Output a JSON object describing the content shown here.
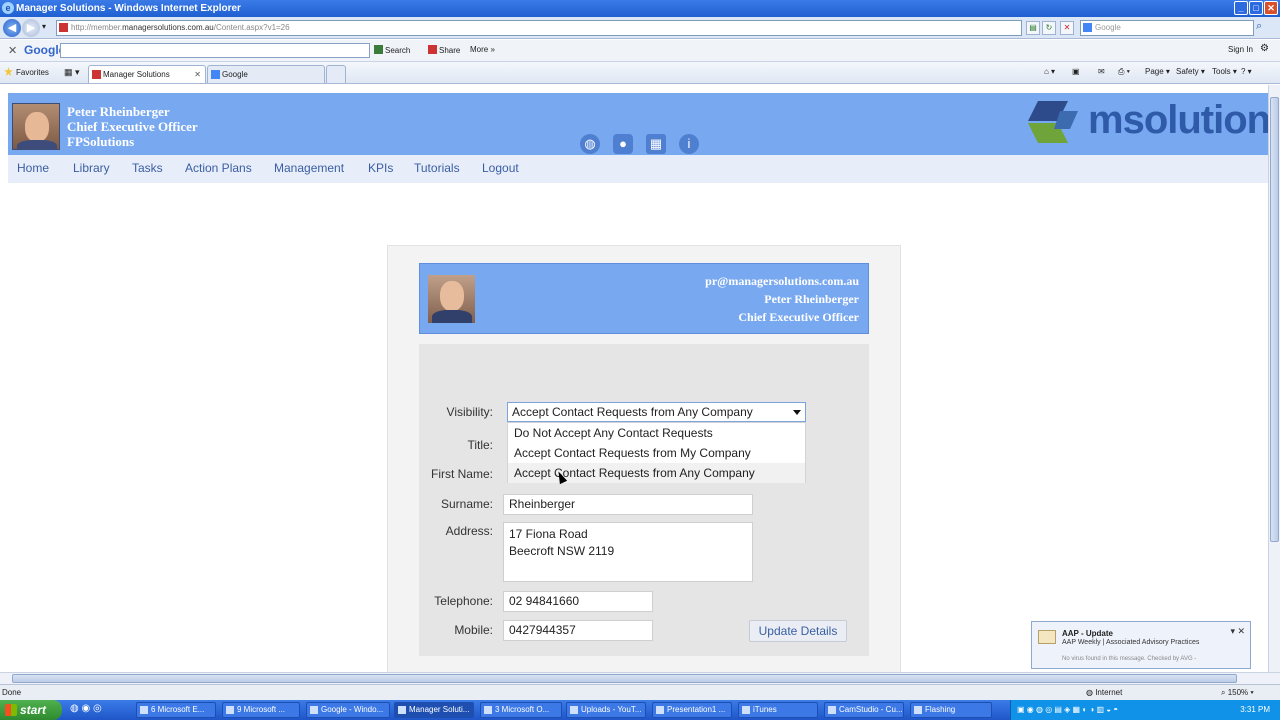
{
  "window": {
    "title": "Manager Solutions - Windows Internet Explorer",
    "url_prefix": "http://member.",
    "url_domain": "managersolutions.com.au",
    "url_path": "/Content.aspx?v1=26",
    "search_placeholder": "Google"
  },
  "google_toolbar": {
    "logo": "Google",
    "search_label": "Search",
    "share_label": "Share",
    "more_label": "More »",
    "signin_label": "Sign In"
  },
  "favorites": {
    "label": "Favorites",
    "tabs": [
      {
        "label": "Manager Solutions"
      },
      {
        "label": "Google"
      }
    ],
    "commands": [
      "Page",
      "Safety",
      "Tools"
    ]
  },
  "header": {
    "name": "Peter Rheinberger",
    "role": "Chief Executive Officer",
    "company": "FPSolutions",
    "brand": "msolutions",
    "icons": [
      "globe-icon",
      "user-icon",
      "calendar-icon",
      "info-icon"
    ]
  },
  "nav": {
    "items": [
      "Home",
      "Library",
      "Tasks",
      "Action Plans",
      "Management",
      "KPIs",
      "Tutorials",
      "Logout"
    ]
  },
  "card": {
    "email": "pr@managersolutions.com.au",
    "name": "Peter Rheinberger",
    "role": "Chief Executive Officer"
  },
  "form": {
    "visibility_label": "Visibility:",
    "visibility_value": "Accept Contact Requests from Any Company",
    "visibility_options": [
      "Do Not Accept Any Contact Requests",
      "Accept Contact Requests from My Company",
      "Accept Contact Requests from Any Company"
    ],
    "title_label": "Title:",
    "firstname_label": "First Name:",
    "surname_label": "Surname:",
    "surname_value": "Rheinberger",
    "address_label": "Address:",
    "address_value": "17 Fiona Road\nBeecroft NSW 2119",
    "telephone_label": "Telephone:",
    "telephone_value": "02 94841660",
    "mobile_label": "Mobile:",
    "mobile_value": "0427944357",
    "update_button": "Update Details"
  },
  "notification": {
    "title": "AAP - Update",
    "subtitle": "AAP Weekly | Associated Advisory Practices",
    "footer": "No virus found in this message. Checked by AVG -"
  },
  "status": {
    "left": "Done",
    "zone": "Internet",
    "zoom": "150%"
  },
  "taskbar": {
    "start": "start",
    "tasks": [
      {
        "label": "6 Microsoft E..."
      },
      {
        "label": "9 Microsoft ..."
      },
      {
        "label": "Google - Windo..."
      },
      {
        "label": "Manager Soluti..."
      },
      {
        "label": "3 Microsoft O..."
      },
      {
        "label": "Uploads - YouT..."
      },
      {
        "label": "Presentation1 ..."
      },
      {
        "label": "iTunes"
      },
      {
        "label": "CamStudio - Cu..."
      },
      {
        "label": "Flashing"
      }
    ],
    "clock": "3:31 PM"
  }
}
